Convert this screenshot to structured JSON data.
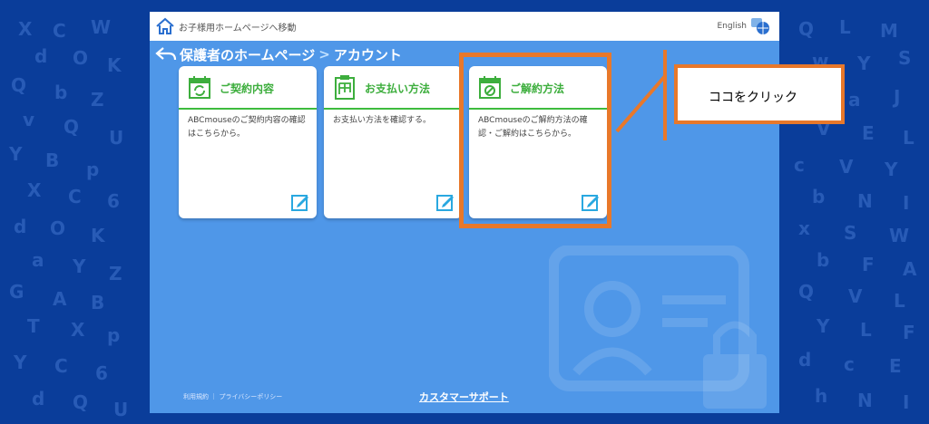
{
  "header": {
    "home_link": "お子様用ホームページへ移動",
    "language": "English"
  },
  "breadcrumb": {
    "parent": "保護者のホームページ",
    "separator": ">",
    "current": "アカウント"
  },
  "cards": [
    {
      "title": "ご契約内容",
      "description": "ABCmouseのご契約内容の確認はこちらから。",
      "icon": "calendar-refresh-icon"
    },
    {
      "title": "お支払い方法",
      "description": "お支払い方法を確認する。",
      "icon": "clipboard-yen-icon"
    },
    {
      "title": "ご解約方法",
      "description": "ABCmouseのご解約方法の確認・ご解約はこちらから。",
      "icon": "calendar-cancel-icon"
    }
  ],
  "callout": {
    "text": "ココをクリック"
  },
  "footer": {
    "links": "利用規約 ｜ プライバシーポリシー",
    "support": "カスタマーサポート"
  },
  "colors": {
    "background": "#0a3d9a",
    "panel": "#4f97e8",
    "accent_green": "#3dae3d",
    "highlight_orange": "#e8782a"
  }
}
